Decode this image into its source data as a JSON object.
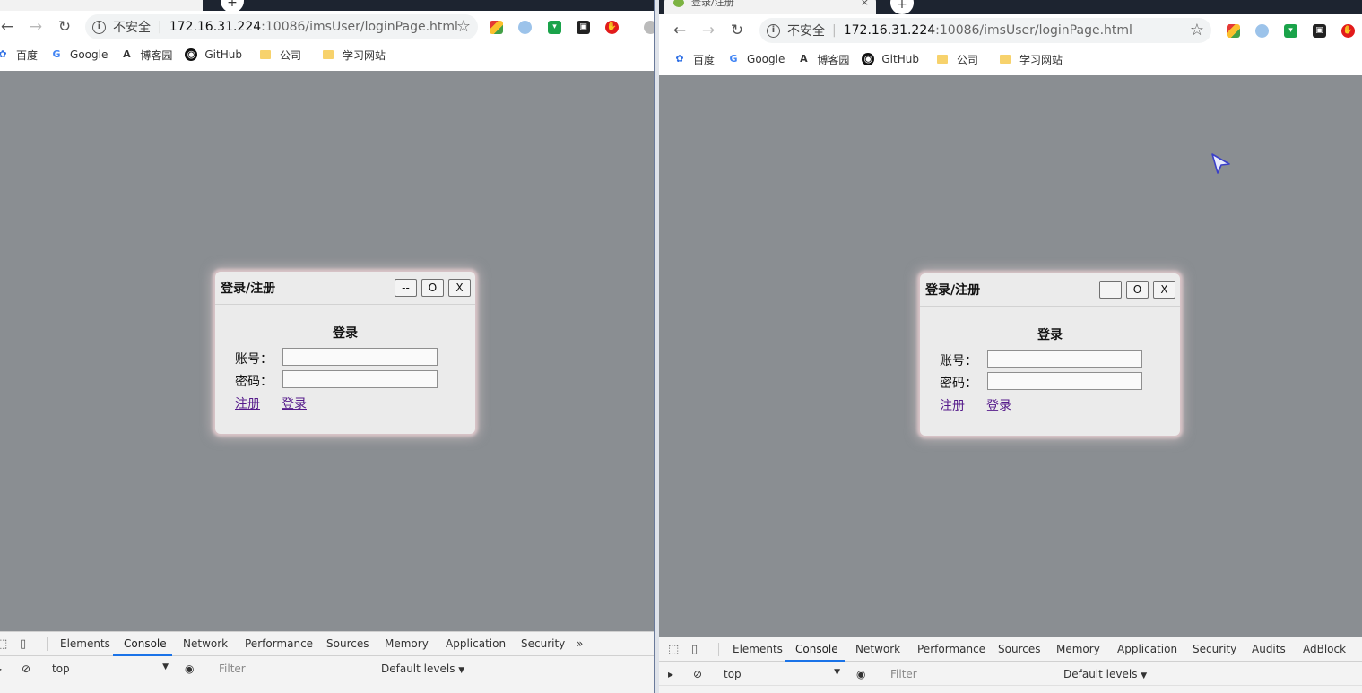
{
  "windows": [
    {
      "id": "left",
      "tab": {
        "new_tab_glyph": "+"
      },
      "address": {
        "insecure_label": "不安全",
        "separator": "|",
        "host": "172.16.31.224",
        "path": ":10086/imsUser/loginPage.html"
      },
      "extensions": [
        {
          "icon": "colorful-cube-icon",
          "color": "#4caf50"
        },
        {
          "icon": "blue-swirl-icon",
          "color": "#6aa0d8"
        },
        {
          "icon": "green-shield-icon",
          "color": "#1aa34a"
        },
        {
          "icon": "black-box-icon",
          "color": "#222222"
        },
        {
          "icon": "red-stop-icon",
          "color": "#e21b1b"
        }
      ],
      "bookmarks": [
        "百度",
        "Google",
        "博客园",
        "GitHub",
        "公司",
        "学习网站"
      ],
      "dialog": {
        "title": "登录/注册",
        "buttons": {
          "minimize": "--",
          "maximize": "O",
          "close": "X"
        },
        "heading": "登录",
        "account_label": "账号：",
        "password_label": "密码：",
        "register_link": "注册",
        "login_link": "登录"
      },
      "devtools": {
        "tabs": [
          "Elements",
          "Console",
          "Network",
          "Performance",
          "Sources",
          "Memory",
          "Application",
          "Security"
        ],
        "active_tab": "Console",
        "overflow": "»",
        "context": "top",
        "filter_placeholder": "Filter",
        "levels": "Default levels"
      }
    },
    {
      "id": "right",
      "tab": {
        "title": "登录/注册",
        "close_glyph": "×",
        "new_tab_glyph": "+"
      },
      "address": {
        "insecure_label": "不安全",
        "separator": "|",
        "host": "172.16.31.224",
        "path": ":10086/imsUser/loginPage.html"
      },
      "bookmarks": [
        "百度",
        "Google",
        "博客园",
        "GitHub",
        "公司",
        "学习网站"
      ],
      "dialog": {
        "title": "登录/注册",
        "buttons": {
          "minimize": "--",
          "maximize": "O",
          "close": "X"
        },
        "heading": "登录",
        "account_label": "账号：",
        "password_label": "密码：",
        "register_link": "注册",
        "login_link": "登录"
      },
      "devtools": {
        "tabs": [
          "Elements",
          "Console",
          "Network",
          "Performance",
          "Sources",
          "Memory",
          "Application",
          "Security",
          "Audits",
          "AdBlock"
        ],
        "active_tab": "Console",
        "context": "top",
        "filter_placeholder": "Filter",
        "levels": "Default levels"
      }
    }
  ],
  "colors": {
    "page_background": "#8a8e92",
    "dialog_background": "#ebebeb",
    "dialog_glow": "#d9c4c7",
    "link": "#551a8b",
    "devtools_accent": "#1a73e8"
  }
}
